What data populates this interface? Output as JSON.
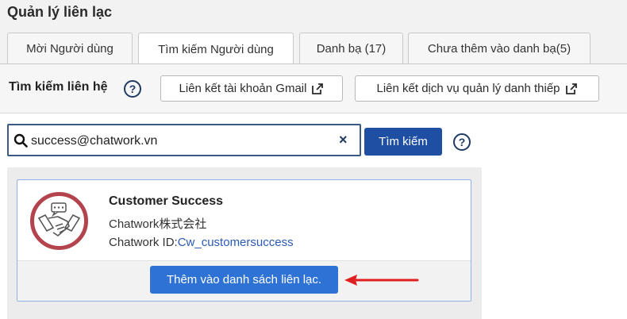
{
  "page": {
    "title": "Quản lý liên lạc"
  },
  "tabs": [
    {
      "label": "Mời Người dùng",
      "active": false
    },
    {
      "label": "Tìm kiếm Người dùng",
      "active": true
    },
    {
      "label": "Danh bạ (17)",
      "active": false
    },
    {
      "label": "Chưa thêm vào danh bạ(5)",
      "active": false
    }
  ],
  "search_section": {
    "title": "Tìm kiếm liên hệ",
    "help_icon": "?",
    "gmail_link_label": "Liên kết tài khoản Gmail",
    "card_service_label": "Liên kết dịch vụ quản lý danh thiếp"
  },
  "search": {
    "value": "success@chatwork.vn",
    "clear_icon": "×",
    "button_label": "Tìm kiếm",
    "help_icon": "?"
  },
  "result": {
    "name": "Customer Success",
    "company": "Chatwork株式会社",
    "id_label": "Chatwork ID:",
    "id_value": "Cw_customersuccess",
    "add_button_label": "Thêm vào danh sách liên lạc."
  },
  "colors": {
    "primary": "#1f4fa3",
    "add_button": "#2f72d6",
    "avatar_ring": "#b3444e",
    "annotation_arrow": "#e02020"
  },
  "icons": [
    "search-icon",
    "clear-icon",
    "help-icon",
    "external-link-icon",
    "handshake-icon",
    "arrow-annotation"
  ]
}
